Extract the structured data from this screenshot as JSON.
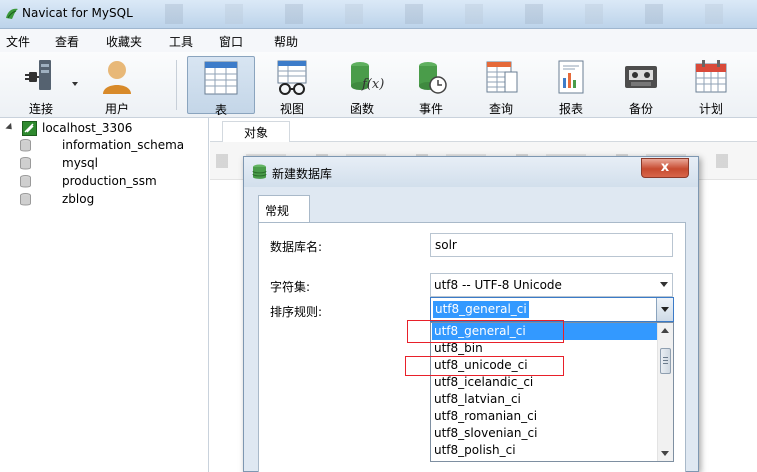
{
  "window": {
    "title": "Navicat for MySQL"
  },
  "menu": [
    "文件",
    "查看",
    "收藏夹",
    "工具",
    "窗口",
    "帮助"
  ],
  "toolbar": {
    "items": [
      {
        "label": "连接",
        "icon": "connect-plug-icon"
      },
      {
        "label": "用户",
        "icon": "user-icon"
      },
      {
        "label": "表",
        "icon": "table-icon",
        "active": true
      },
      {
        "label": "视图",
        "icon": "view-glasses-icon"
      },
      {
        "label": "函数",
        "icon": "function-icon"
      },
      {
        "label": "事件",
        "icon": "event-clock-icon"
      },
      {
        "label": "查询",
        "icon": "query-icon"
      },
      {
        "label": "报表",
        "icon": "report-icon"
      },
      {
        "label": "备份",
        "icon": "backup-icon"
      },
      {
        "label": "计划",
        "icon": "schedule-calendar-icon"
      }
    ]
  },
  "tree": {
    "connection": "localhost_3306",
    "databases": [
      "information_schema",
      "mysql",
      "production_ssm",
      "zblog"
    ]
  },
  "right": {
    "tab_label": "对象"
  },
  "dialog": {
    "title": "新建数据库",
    "close_glyph": "x",
    "tab_label": "常规",
    "fields": {
      "name_label": "数据库名:",
      "name_value": "solr",
      "charset_label": "字符集:",
      "charset_value": "utf8 -- UTF-8 Unicode",
      "collation_label": "排序规则:",
      "collation_value": "utf8_general_ci"
    },
    "collation_options": [
      "utf8_general_ci",
      "utf8_bin",
      "utf8_unicode_ci",
      "utf8_icelandic_ci",
      "utf8_latvian_ci",
      "utf8_romanian_ci",
      "utf8_slovenian_ci",
      "utf8_polish_ci"
    ],
    "selected_option_index": 0,
    "highlighted_options": [
      "utf8_general_ci",
      "utf8_unicode_ci"
    ]
  },
  "colors": {
    "selection": "#3399ff",
    "annotation_red": "#e8202a",
    "close_red": "#c74b30"
  }
}
